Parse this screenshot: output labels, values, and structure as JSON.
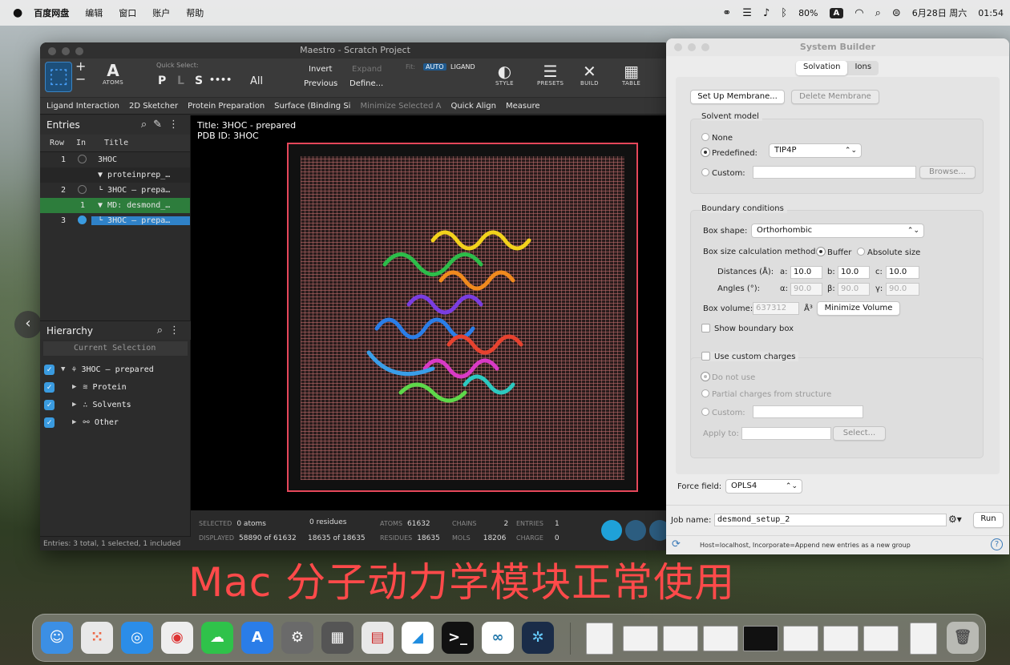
{
  "menubar": {
    "app": "百度网盘",
    "items": [
      "编辑",
      "窗口",
      "账户",
      "帮助"
    ],
    "battery": "80%",
    "input_badge": "A",
    "date": "6月28日 周六",
    "time": "01:54"
  },
  "maestro": {
    "title": "Maestro - Scratch Project",
    "toolbar": {
      "atoms_label": "ATOMS",
      "quick_select_label": "Quick Select:",
      "qs_p": "P",
      "qs_l": "L",
      "qs_s": "S",
      "qs_more": "••••",
      "qs_all": "All",
      "invert": "Invert",
      "expand": "Expand",
      "previous": "Previous",
      "define": "Define...",
      "fit_label": "Fit:",
      "auto": "AUTO",
      "ligand": "LIGAND",
      "style": "STYLE",
      "presets": "PRESETS",
      "build": "BUILD",
      "table": "TABLE"
    },
    "workflows": [
      "Ligand Interaction",
      "2D Sketcher",
      "Protein Preparation",
      "Surface (Binding Si",
      "Minimize Selected A",
      "Quick Align",
      "Measure"
    ],
    "entries": {
      "title": "Entries",
      "col_row": "Row",
      "col_in": "In",
      "col_title": "Title",
      "rows": [
        {
          "row": "1",
          "title": "3HOC"
        },
        {
          "row": "",
          "title": "proteinprep_…"
        },
        {
          "row": "2",
          "title": "3HOC – prepa…"
        },
        {
          "row": "1",
          "title": "MD: desmond_…"
        },
        {
          "row": "3",
          "title": "3HOC – prepa…"
        }
      ]
    },
    "hierarchy": {
      "title": "Hierarchy",
      "current_selection": "Current Selection",
      "items": [
        {
          "label": "3HOC – prepared"
        },
        {
          "label": "Protein"
        },
        {
          "label": "Solvents"
        },
        {
          "label": "Other"
        }
      ]
    },
    "entries_footer": "Entries: 3 total, 1 selected, 1 included",
    "viewer": {
      "title_line": "Title: 3HOC - prepared",
      "pdb_line": "PDB ID: 3HOC"
    },
    "status": {
      "selected_k": "SELECTED",
      "selected_atoms": "0 atoms",
      "selected_res": "0 residues",
      "displayed_k": "DISPLAYED",
      "displayed_atoms": "58890 of 61632",
      "displayed_res": "18635 of 18635",
      "atoms_k": "ATOMS",
      "atoms": "61632",
      "residues_k": "RESIDUES",
      "residues": "18635",
      "chains_k": "CHAINS",
      "chains": "2",
      "mols_k": "MOLS",
      "mols": "18206",
      "entries_k": "ENTRIES",
      "entries": "1",
      "charge_k": "CHARGE",
      "charge": "0"
    }
  },
  "sysbuilder": {
    "title": "System Builder",
    "tab_solvation": "Solvation",
    "tab_ions": "Ions",
    "setup_membrane": "Set Up Membrane...",
    "delete_membrane": "Delete Membrane",
    "solvent_model": "Solvent model",
    "none": "None",
    "predefined": "Predefined:",
    "predefined_value": "TIP4P",
    "custom": "Custom:",
    "browse": "Browse...",
    "boundary": "Boundary conditions",
    "box_shape": "Box shape:",
    "box_shape_value": "Orthorhombic",
    "box_calc": "Box size calculation method:",
    "buffer": "Buffer",
    "absolute": "Absolute size",
    "distances": "Distances (Å):",
    "a": "a:",
    "b": "b:",
    "c": "c:",
    "dist_a": "10.0",
    "dist_b": "10.0",
    "dist_c": "10.0",
    "angles": "Angles (°):",
    "alpha": "α:",
    "beta": "β:",
    "gamma": "γ:",
    "ang_a": "90.0",
    "ang_b": "90.0",
    "ang_c": "90.0",
    "box_volume": "Box volume:",
    "box_volume_value": "637312",
    "volume_unit": "Å³",
    "minimize_volume": "Minimize Volume",
    "show_boundary": "Show boundary box",
    "use_custom_charges": "Use custom charges",
    "do_not_use": "Do not use",
    "partial": "Partial charges from structure",
    "custom2": "Custom:",
    "apply_to": "Apply to:",
    "select": "Select...",
    "force_field": "Force field:",
    "force_field_value": "OPLS4",
    "job_name": "Job name:",
    "job_name_value": "desmond_setup_2",
    "run": "Run",
    "host_line": "Host=localhost, Incorporate=Append new entries as a new group"
  },
  "caption": "Mac 分子动力学模块正常使用"
}
